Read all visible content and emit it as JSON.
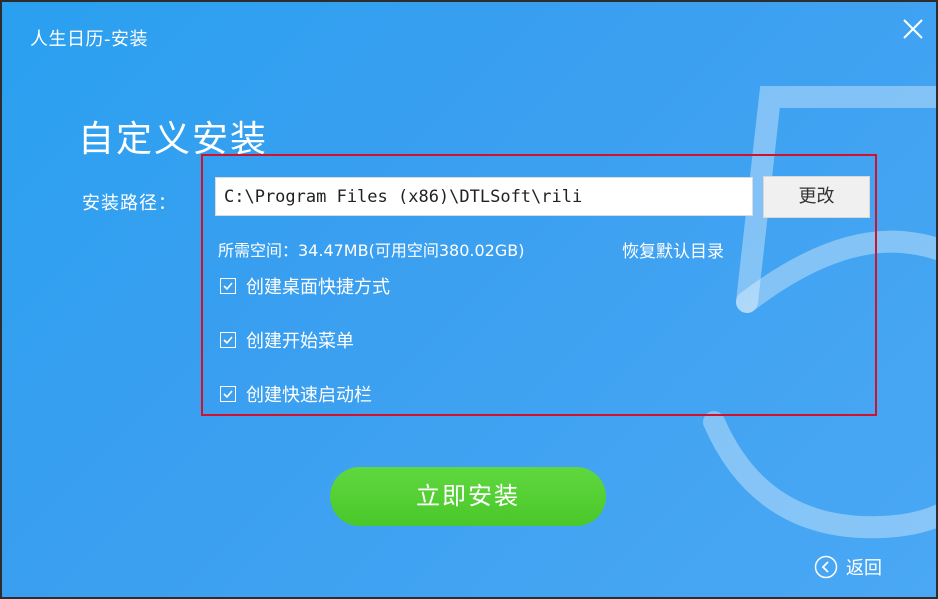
{
  "window": {
    "title": "人生日历-安装"
  },
  "main": {
    "heading": "自定义安装",
    "path_label": "安装路径：",
    "path_value": "C:\\Program Files (x86)\\DTLSoft\\rili",
    "change_button": "更改",
    "space_info": "所需空间：34.47MB(可用空间380.02GB)",
    "restore_default": "恢复默认目录",
    "options": [
      {
        "label": "创建桌面快捷方式",
        "checked": true
      },
      {
        "label": "创建开始菜单",
        "checked": true
      },
      {
        "label": "创建快速启动栏",
        "checked": true
      }
    ],
    "install_button": "立即安装",
    "back_label": "返回"
  },
  "colors": {
    "background": "#3a9ff0",
    "install_green": "#4ac72a",
    "highlight_border": "#d0122a"
  },
  "icons": {
    "close": "close-icon",
    "checkbox": "checkmark-icon",
    "back": "back-arrow-icon"
  }
}
